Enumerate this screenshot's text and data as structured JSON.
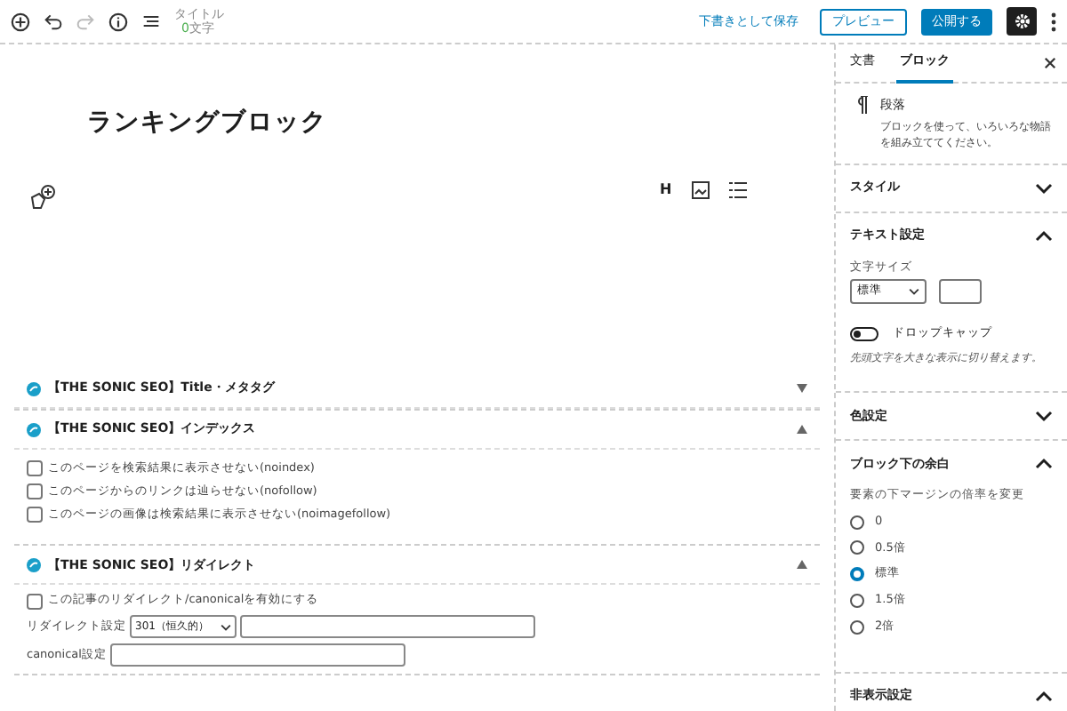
{
  "topbar": {
    "title_label": "タイトル",
    "char_count": "0",
    "char_unit": "文字",
    "save_draft": "下書きとして保存",
    "preview": "プレビュー",
    "publish": "公開する",
    "settings_active": true
  },
  "editor": {
    "heading": "ランキングブロック",
    "toolbar": [
      "H"
    ]
  },
  "meta_boxes": [
    {
      "title": "【THE SONIC SEO】Title・メタタグ",
      "expanded": false,
      "kind": "empty"
    },
    {
      "title": "【THE SONIC SEO】インデックス",
      "expanded": true,
      "kind": "checks",
      "checks": [
        {
          "label": "このページを検索結果に表示させない(noindex)",
          "checked": false
        },
        {
          "label": "このページからのリンクは辿らせない(nofollow)",
          "checked": false
        },
        {
          "label": "このページの画像は検索結果に表示させない(noimagefollow)",
          "checked": false
        }
      ]
    },
    {
      "title": "【THE SONIC SEO】リダイレクト",
      "expanded": true,
      "kind": "redirect",
      "checks": [
        {
          "label": "この記事のリダイレクト/canonicalを有効にする",
          "checked": false
        }
      ],
      "redirect_label": "リダイレクト設定",
      "redirect_select": "301（恒久的）",
      "canonical_label": "canonical設定"
    }
  ],
  "sidebar": {
    "tabs": [
      {
        "label": "文書",
        "selected": false
      },
      {
        "label": "ブロック",
        "selected": true
      }
    ],
    "block": {
      "name": "段落",
      "description": "ブロックを使って、いろいろな物語を組み立ててください。"
    },
    "panels": [
      {
        "title": "スタイル",
        "expanded": false,
        "kind": "empty"
      },
      {
        "title": "テキスト設定",
        "expanded": true,
        "kind": "text",
        "size_label": "文字サイズ",
        "size_select": "標準",
        "toggle_label": "ドロップキャップ",
        "toggle_on": false,
        "help": "先頭文字を大きな表示に切り替えます。"
      },
      {
        "title": "色設定",
        "expanded": false,
        "kind": "empty"
      },
      {
        "title": "ブロック下の余白",
        "expanded": true,
        "kind": "radios",
        "label": "要素の下マージンの倍率を変更",
        "options": [
          {
            "label": "0",
            "selected": false
          },
          {
            "label": "0.5倍",
            "selected": false
          },
          {
            "label": "標準",
            "selected": true
          },
          {
            "label": "1.5倍",
            "selected": false
          },
          {
            "label": "2倍",
            "selected": false
          }
        ]
      },
      {
        "title": "非表示設定",
        "expanded": true,
        "kind": "empty"
      }
    ]
  }
}
